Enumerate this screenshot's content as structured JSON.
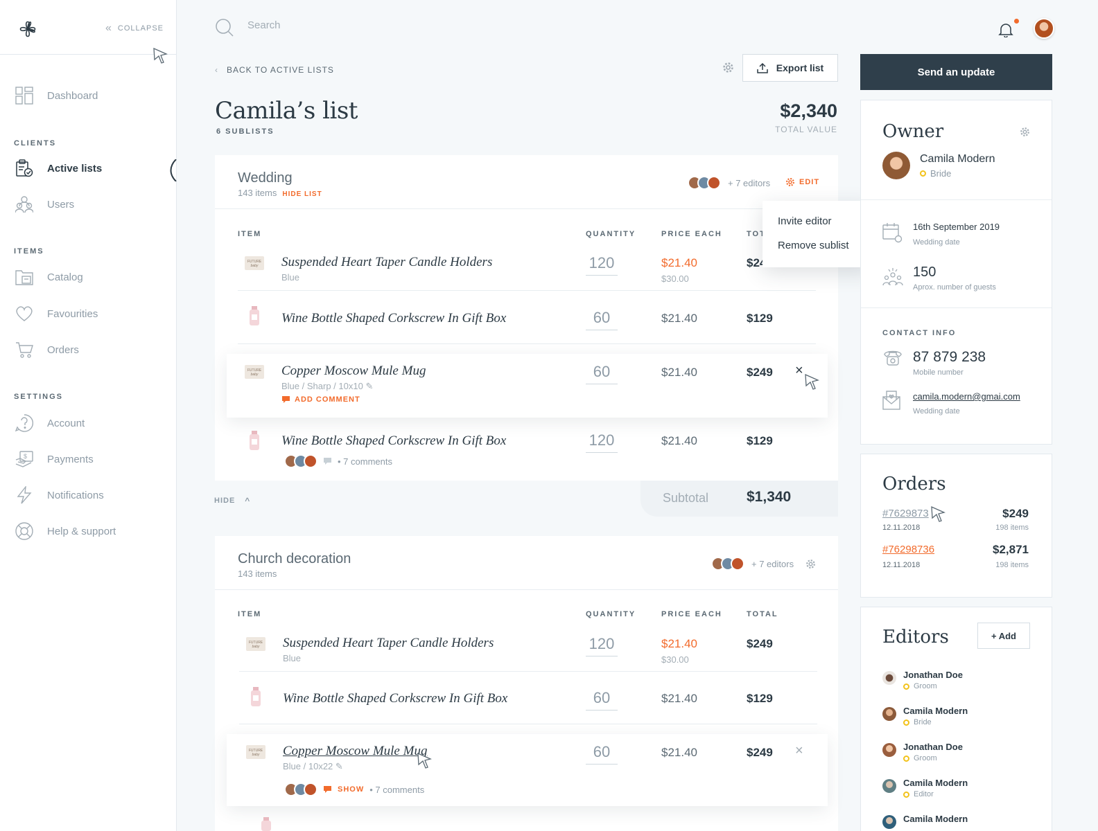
{
  "sidebar": {
    "collapse_label": "COLLAPSE",
    "sections": {
      "clients": "CLIENTS",
      "items": "ITEMS",
      "settings": "SETTINGS"
    },
    "items": {
      "dashboard": "Dashboard",
      "active_lists": "Active lists",
      "users": "Users",
      "catalog": "Catalog",
      "favourites": "Favourities",
      "orders": "Orders",
      "account": "Account",
      "payments": "Payments",
      "notifications": "Notifications",
      "help": "Help & support"
    }
  },
  "search": {
    "placeholder": "Search"
  },
  "header": {
    "back_label": "BACK TO ACTIVE LISTS",
    "export_label": "Export list",
    "send_update_label": "Send an update",
    "title": "Camila’s list",
    "sublists": "6 SUBLISTS",
    "total_value": "$2,340",
    "total_label": "TOTAL VALUE"
  },
  "wedding": {
    "title": "Wedding",
    "count": "143 items",
    "hide_list": "HIDE LIST",
    "editors": "+ 7 editors",
    "edit": "EDIT",
    "columns": {
      "item": "ITEM",
      "quantity": "QUANTITY",
      "price": "PRICE EACH",
      "total": "TOT"
    },
    "rows": [
      {
        "name": "Suspended Heart Taper Candle Holders",
        "meta": "Blue",
        "qty": "120",
        "price": "$21.40",
        "old": "$30.00",
        "total": "$24"
      },
      {
        "name": "Wine Bottle Shaped Corkscrew In Gift Box",
        "qty": "60",
        "price": "$21.40",
        "total": "$129"
      },
      {
        "name": "Copper Moscow Mule Mug",
        "meta": "Blue  /  Sharp  /  10x10",
        "comment": "ADD COMMENT",
        "qty": "60",
        "price": "$21.40",
        "total": "$249"
      },
      {
        "name": "Wine Bottle Shaped Corkscrew In Gift Box",
        "comments": "• 7 comments",
        "qty": "120",
        "price": "$21.40",
        "total": "$129"
      }
    ],
    "hide": "HIDE",
    "subtotal_label": "Subtotal",
    "subtotal_value": "$1,340"
  },
  "dropdown": {
    "invite": "Invite editor",
    "remove": "Remove sublist"
  },
  "church": {
    "title": "Church decoration",
    "count": "143 items",
    "editors": "+ 7 editors",
    "columns": {
      "item": "ITEM",
      "quantity": "QUANTITY",
      "price": "PRICE EACH",
      "total": "TOTAL"
    },
    "rows": [
      {
        "name": "Suspended Heart Taper Candle Holders",
        "meta": "Blue",
        "qty": "120",
        "price": "$21.40",
        "old": "$30.00",
        "total": "$249"
      },
      {
        "name": "Wine Bottle Shaped Corkscrew In Gift Box",
        "qty": "60",
        "price": "$21.40",
        "total": "$129"
      },
      {
        "name": "Copper Moscow Mule Mug",
        "meta": "Blue  /  10x22",
        "show": "SHOW",
        "comments": "• 7 comments",
        "qty": "60",
        "price": "$21.40",
        "total": "$249"
      }
    ]
  },
  "owner": {
    "title": "Owner",
    "name": "Camila Modern",
    "role": "Bride",
    "date": "16th September 2019",
    "date_label": "Wedding date",
    "guests": "150",
    "guests_label": "Aprox. number of guests",
    "contact_heading": "CONTACT INFO",
    "phone": "87  879 238",
    "phone_label": "Mobile number",
    "email": "camila.modern@gmai.com",
    "email_label": "Wedding date"
  },
  "orders": {
    "title": "Orders",
    "items": [
      {
        "id": "#7629873",
        "date": "12.11.2018",
        "amount": "$249",
        "count": "198 items"
      },
      {
        "id": "#76298736",
        "date": "12.11.2018",
        "amount": "$2,871",
        "count": "198 items"
      }
    ]
  },
  "editors": {
    "title": "Editors",
    "add_label": "+ Add",
    "list": [
      {
        "name": "Jonathan Doe",
        "role": "Groom"
      },
      {
        "name": "Camila Modern",
        "role": "Bride"
      },
      {
        "name": "Jonathan Doe",
        "role": "Groom"
      },
      {
        "name": "Camila Modern",
        "role": "Editor"
      },
      {
        "name": "Camila Modern"
      }
    ]
  },
  "colors": {
    "accent": "#f26b2c",
    "dark": "#2f3f4b",
    "role_dot": "#f2c21a"
  }
}
